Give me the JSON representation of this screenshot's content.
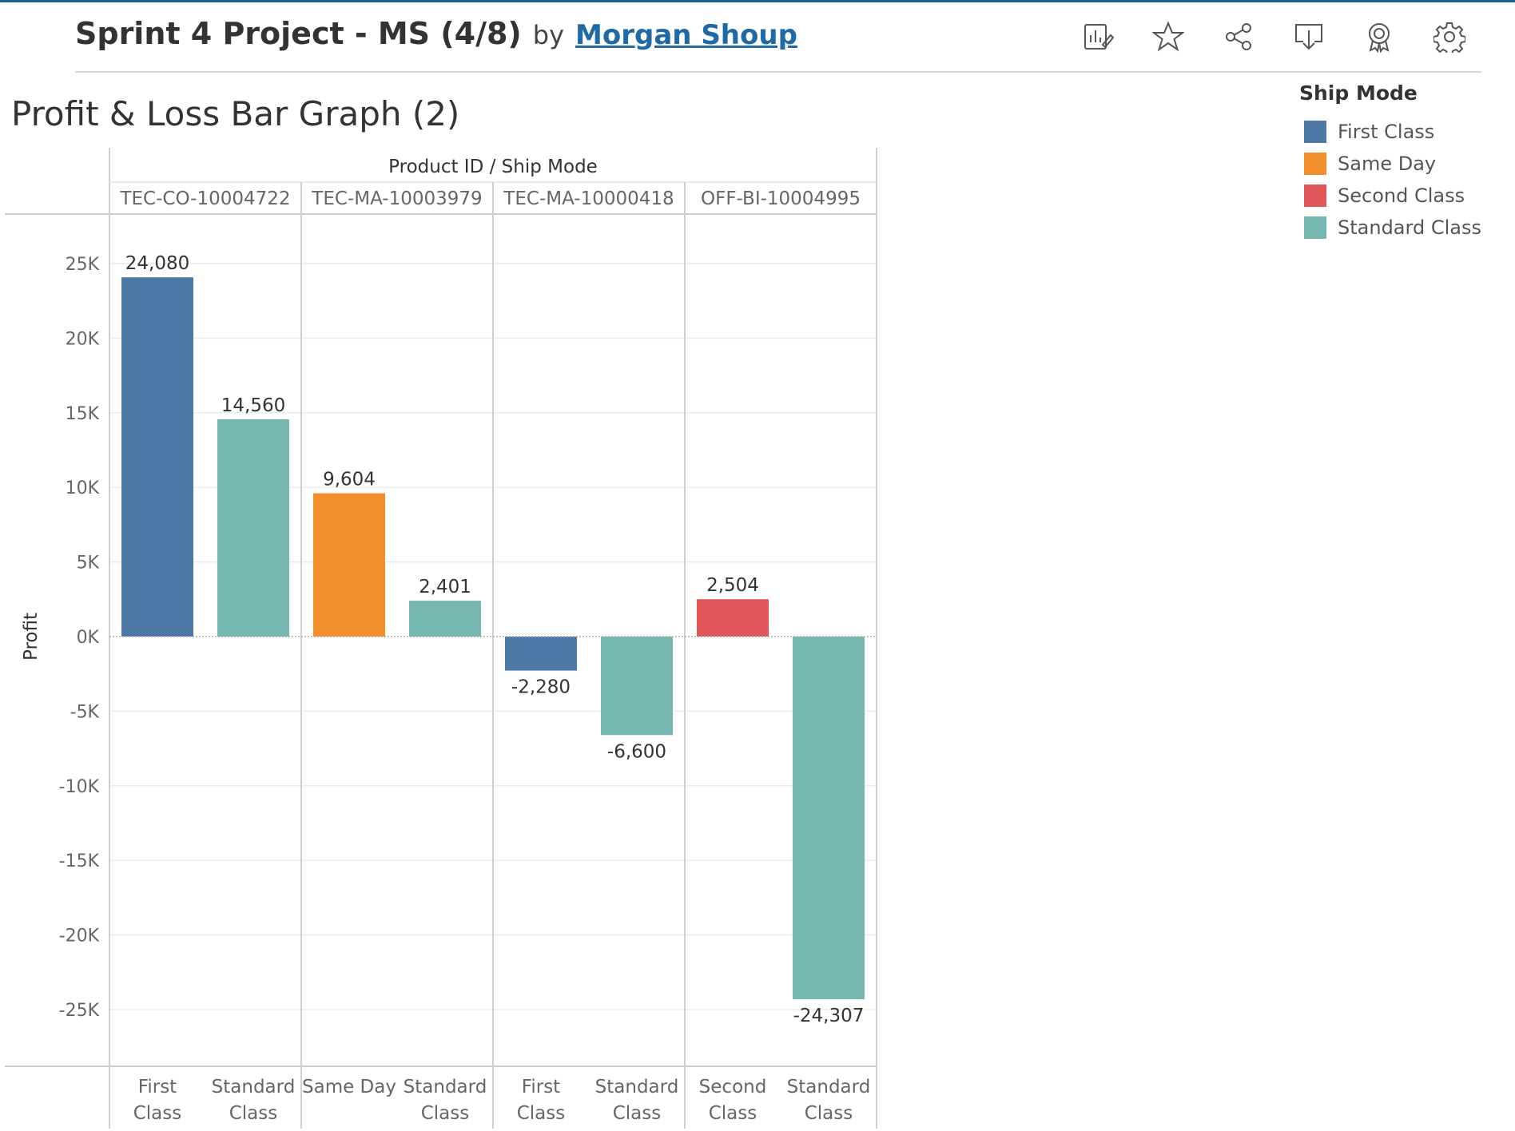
{
  "header": {
    "title": "Sprint 4 Project - MS (4/8)",
    "by": "by",
    "author": "Morgan Shoup"
  },
  "toolbar": [
    {
      "icon": "view-data-icon"
    },
    {
      "icon": "star-icon"
    },
    {
      "icon": "share-icon"
    },
    {
      "icon": "download-icon"
    },
    {
      "icon": "badge-icon"
    },
    {
      "icon": "gear-icon"
    }
  ],
  "view_title": "Profit & Loss Bar Graph (2)",
  "legend": {
    "title": "Ship Mode",
    "items": [
      {
        "label": "First Class",
        "color": "#4e79a7"
      },
      {
        "label": "Same Day",
        "color": "#f28e2b"
      },
      {
        "label": "Second Class",
        "color": "#e15759"
      },
      {
        "label": "Standard Class",
        "color": "#76b7b2"
      }
    ]
  },
  "chart_data": {
    "type": "bar",
    "title": "Profit & Loss Bar Graph (2)",
    "column_header": "Product ID / Ship Mode",
    "ylabel": "Profit",
    "ylim": [
      -28000,
      28000
    ],
    "yticks": [
      25000,
      20000,
      15000,
      10000,
      5000,
      0,
      -5000,
      -10000,
      -15000,
      -20000,
      -25000
    ],
    "ytick_labels": [
      "25K",
      "20K",
      "15K",
      "10K",
      "5K",
      "0K",
      "-5K",
      "-10K",
      "-15K",
      "-20K",
      "-25K"
    ],
    "grid": true,
    "legend_position": "top-right",
    "groups": [
      {
        "product": "TEC-CO-10004722",
        "bars": [
          {
            "ship_mode": "First Class",
            "category_label": [
              "First",
              "Class"
            ],
            "value": 24080,
            "label": "24,080"
          },
          {
            "ship_mode": "Standard Class",
            "category_label": [
              "Standard",
              "Class"
            ],
            "value": 14560,
            "label": "14,560"
          }
        ]
      },
      {
        "product": "TEC-MA-10003979",
        "bars": [
          {
            "ship_mode": "Same Day",
            "category_label": [
              "Same Day"
            ],
            "value": 9604,
            "label": "9,604"
          },
          {
            "ship_mode": "Standard Class",
            "category_label": [
              "Standard",
              "Class"
            ],
            "value": 2401,
            "label": "2,401"
          }
        ]
      },
      {
        "product": "TEC-MA-10000418",
        "bars": [
          {
            "ship_mode": "First Class",
            "category_label": [
              "First",
              "Class"
            ],
            "value": -2280,
            "label": "-2,280"
          },
          {
            "ship_mode": "Standard Class",
            "category_label": [
              "Standard",
              "Class"
            ],
            "value": -6600,
            "label": "-6,600"
          }
        ]
      },
      {
        "product": "OFF-BI-10004995",
        "bars": [
          {
            "ship_mode": "Second Class",
            "category_label": [
              "Second",
              "Class"
            ],
            "value": 2504,
            "label": "2,504"
          },
          {
            "ship_mode": "Standard Class",
            "category_label": [
              "Standard",
              "Class"
            ],
            "value": -24307,
            "label": "-24,307"
          }
        ]
      }
    ]
  }
}
